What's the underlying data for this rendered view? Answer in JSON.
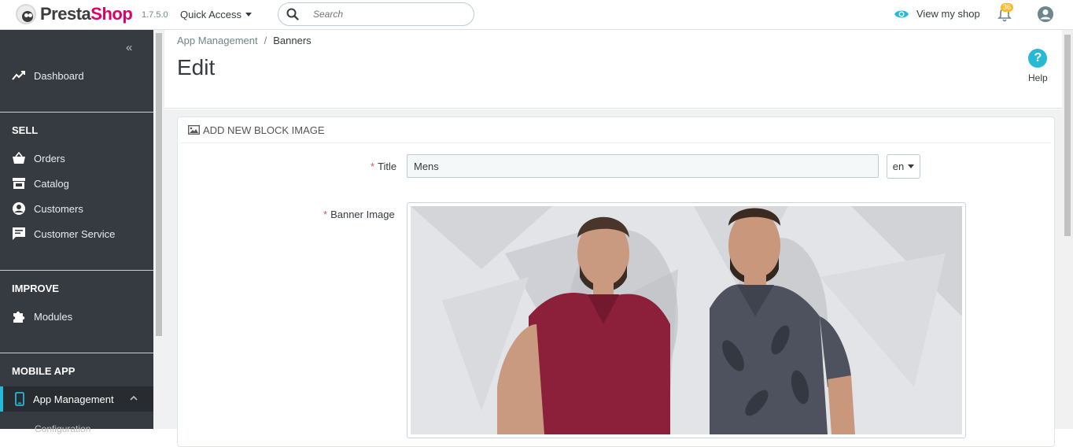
{
  "header": {
    "logo_text_a": "Presta",
    "logo_text_b": "Shop",
    "version": "1.7.5.0",
    "quick_access": "Quick Access",
    "search_placeholder": "Search",
    "view_shop": "View my shop",
    "notifications_count": "36",
    "icons": [
      "search-icon",
      "eye-icon",
      "bell-icon",
      "user-icon"
    ]
  },
  "sidebar": {
    "collapse": "«",
    "dashboard": "Dashboard",
    "sections": {
      "sell": "SELL",
      "improve": "IMPROVE",
      "mobile_app": "MOBILE APP"
    },
    "sell_items": [
      "Orders",
      "Catalog",
      "Customers",
      "Customer Service"
    ],
    "improve_items": [
      "Modules"
    ],
    "mobile_items": [
      "App Management"
    ],
    "sub_item": "Configuration",
    "active_color": "#25b9d7"
  },
  "content": {
    "breadcrumb": [
      "App Management",
      "Banners"
    ],
    "breadcrumb_sep": "/",
    "title": "Edit",
    "help_label": "Help",
    "help_icon": "?"
  },
  "panel": {
    "heading": "ADD NEW BLOCK IMAGE",
    "title_label": "Title",
    "title_value": "Mens",
    "language": "en",
    "banner_label": "Banner Image",
    "required_mark": "*"
  }
}
